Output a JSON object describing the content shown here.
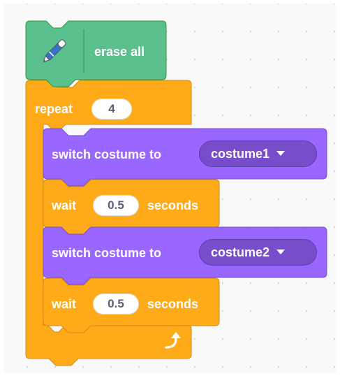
{
  "blocks": {
    "erase_all": {
      "label": "erase all",
      "icon": "pen-icon"
    },
    "repeat": {
      "label": "repeat",
      "times": "4"
    },
    "switch1": {
      "label": "switch costume to",
      "value": "costume1"
    },
    "wait1": {
      "label": "wait",
      "value": "0.5",
      "unit": "seconds"
    },
    "switch2": {
      "label": "switch costume to",
      "value": "costume2"
    },
    "wait2": {
      "label": "wait",
      "value": "0.5",
      "unit": "seconds"
    }
  },
  "colors": {
    "pen": "#59c08e",
    "control": "#ffab19",
    "looks": "#9966ff",
    "looks_dropdown": "#774dcb"
  },
  "icons": [
    "pen-icon",
    "dropdown-caret-icon",
    "loop-arrow-icon"
  ]
}
